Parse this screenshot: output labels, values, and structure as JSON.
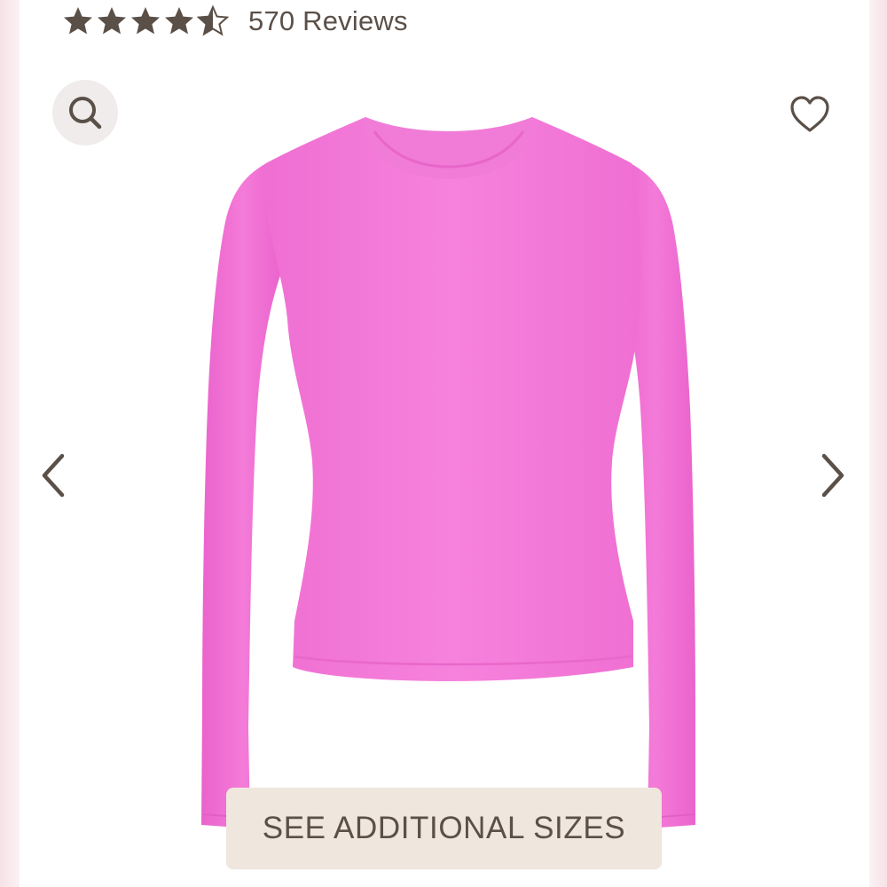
{
  "rating": {
    "value": 4.5,
    "max": 5,
    "reviews_label": "570 Reviews"
  },
  "icons": {
    "zoom": "search-icon",
    "wishlist": "heart-outline-icon",
    "previous": "chevron-left-icon",
    "next": "chevron-right-icon",
    "star": "star-icon"
  },
  "product": {
    "image_subject": "pink-long-sleeve-top"
  },
  "actions": {
    "sizes_label": "SEE ADDITIONAL SIZES"
  },
  "colors": {
    "text": "#5b5048",
    "icon": "#5b5048",
    "button_bg": "#efe6de",
    "zoom_bg": "#efeceb",
    "product": "#f47fdc"
  }
}
